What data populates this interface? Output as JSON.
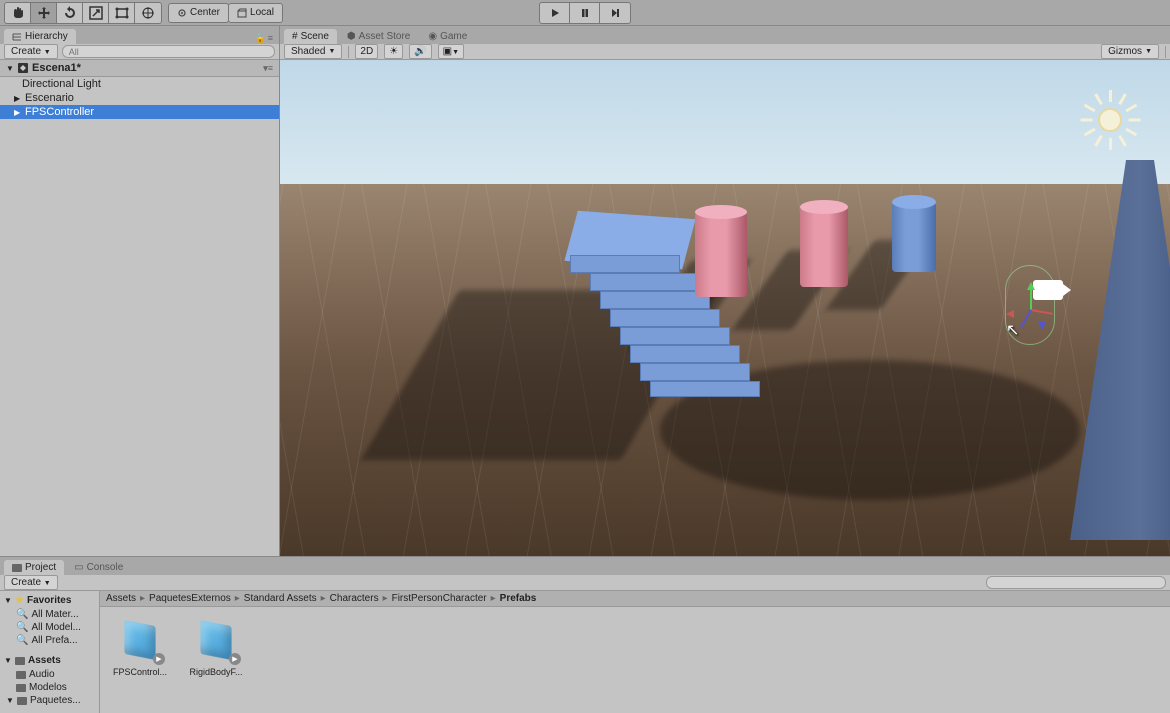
{
  "toolbar": {
    "pivot_center": "Center",
    "pivot_local": "Local"
  },
  "hierarchy": {
    "tab": "Hierarchy",
    "create": "Create",
    "search_placeholder": "All",
    "scene_name": "Escena1*",
    "items": [
      {
        "label": "Directional Light",
        "has_children": false
      },
      {
        "label": "Escenario",
        "has_children": true
      },
      {
        "label": "FPSController",
        "has_children": true,
        "selected": true
      }
    ]
  },
  "scene": {
    "tabs": [
      {
        "label": "Scene",
        "active": true
      },
      {
        "label": "Asset Store",
        "active": false
      },
      {
        "label": "Game",
        "active": false
      }
    ],
    "shaded": "Shaded",
    "mode_2d": "2D",
    "gizmos": "Gizmos"
  },
  "project": {
    "tab_project": "Project",
    "tab_console": "Console",
    "create": "Create",
    "favorites": "Favorites",
    "fav_items": [
      "All Mater...",
      "All Model...",
      "All Prefa..."
    ],
    "assets_header": "Assets",
    "folders": [
      "Audio",
      "Modelos",
      "Paquetes..."
    ],
    "breadcrumb": [
      "Assets",
      "PaquetesExternos",
      "Standard Assets",
      "Characters",
      "FirstPersonCharacter",
      "Prefabs"
    ],
    "items": [
      {
        "label": "FPSControl..."
      },
      {
        "label": "RigidBodyF..."
      }
    ]
  }
}
